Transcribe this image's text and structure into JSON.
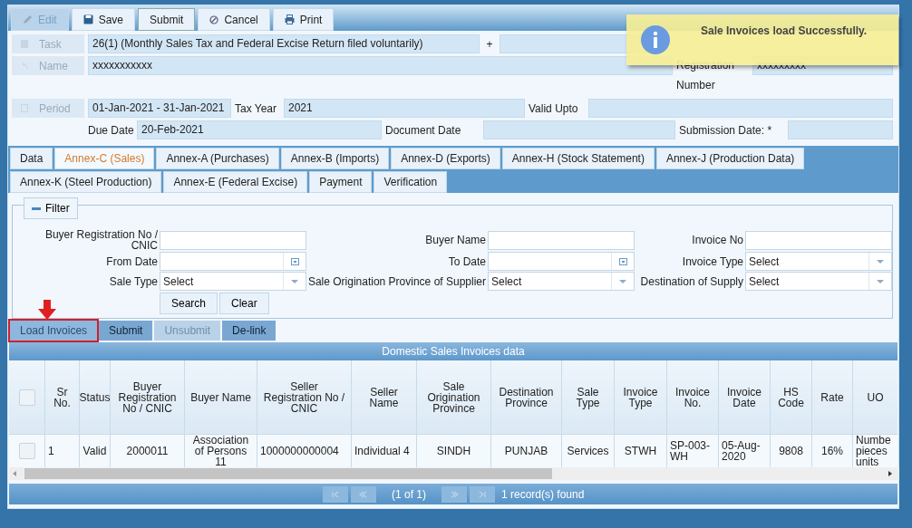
{
  "toolbar": [
    {
      "label": "Edit",
      "disabled": true
    },
    {
      "label": "Save",
      "disabled": false
    },
    {
      "label": "Submit",
      "disabled": false
    },
    {
      "label": "Cancel",
      "disabled": false
    },
    {
      "label": "Print",
      "disabled": false
    }
  ],
  "header": {
    "task_label": "Task",
    "task": "26(1) (Monthly Sales Tax and Federal Excise Return filed voluntarily)",
    "plus": "+",
    "name_label": "Name",
    "name": "xxxxxxxxxxx",
    "registration_label": "Registration Number",
    "registration": "xxxxxxxxx",
    "period_label": "Period",
    "period": "01-Jan-2021 -  31-Jan-2021",
    "tax_year_label": "Tax Year",
    "tax_year": "2021",
    "valid_upto_label": "Valid Upto",
    "due_date_label": "Due Date",
    "due_date": "20-Feb-2021",
    "document_date_label": "Document Date",
    "submission_date_label": "Submission Date: *"
  },
  "toast": {
    "message": "Sale Invoices load Successfully."
  },
  "tab_rows": [
    [
      {
        "label": "Data",
        "selected": false
      },
      {
        "label": "Annex-C (Sales)",
        "selected": true
      },
      {
        "label": "Annex-A (Purchases)",
        "selected": false
      },
      {
        "label": "Annex-B (Imports)",
        "selected": false
      },
      {
        "label": "Annex-D (Exports)",
        "selected": false
      },
      {
        "label": "Annex-H (Stock Statement)",
        "selected": false
      },
      {
        "label": "Annex-J (Production Data)",
        "selected": false
      }
    ],
    [
      {
        "label": "Annex-K (Steel Production)",
        "selected": false
      },
      {
        "label": "Annex-E (Federal Excise)",
        "selected": false
      },
      {
        "label": "Payment",
        "selected": false
      },
      {
        "label": "Verification",
        "selected": false
      }
    ]
  ],
  "filter": {
    "legend": "Filter",
    "expanded": true,
    "fields": [
      {
        "label": "Buyer Registration No / CNIC",
        "kind": "text"
      },
      {
        "label": "Buyer Name",
        "kind": "text"
      },
      {
        "label": "Invoice No",
        "kind": "text"
      },
      {
        "label": "From Date",
        "kind": "date"
      },
      {
        "label": "To Date",
        "kind": "date"
      },
      {
        "label": "Invoice Type",
        "kind": "select",
        "value": "Select"
      },
      {
        "label": "Sale Type",
        "kind": "select",
        "value": "Select"
      },
      {
        "label": "Sale Origination Province of Supplier",
        "kind": "select",
        "value": "Select"
      },
      {
        "label": "Destination of Supply",
        "kind": "select",
        "value": "Select"
      }
    ],
    "buttons": [
      "Search",
      "Clear"
    ]
  },
  "actions": [
    {
      "label": "Load Invoices",
      "disabled": false,
      "highlighted": true
    },
    {
      "label": "Submit",
      "disabled": false,
      "highlighted": false
    },
    {
      "label": "Unsubmit",
      "disabled": true,
      "highlighted": false
    },
    {
      "label": "De-link",
      "disabled": false,
      "highlighted": false
    }
  ],
  "grid": {
    "title": "Domestic Sales Invoices data",
    "select_all": false,
    "columns": [
      "Sr No.",
      "Status",
      "Buyer Registration No / CNIC",
      "Buyer Name",
      "Seller Registration No / CNIC",
      "Seller Name",
      "Sale Origination Province",
      "Destination Province",
      "Sale Type",
      "Invoice Type",
      "Invoice No.",
      "Invoice Date",
      "HS Code",
      "Rate",
      "UO"
    ],
    "rows": [
      {
        "checked": false,
        "cells": [
          "1",
          "Valid",
          "2000011",
          "Association of Persons 11",
          "1000000000004",
          "Individual 4",
          "SINDH",
          "PUNJAB",
          "Services",
          "STWH",
          "SP-003-WH",
          "05-Aug-2020",
          "9808",
          "16%",
          "Numbe pieces units"
        ]
      }
    ],
    "page": "(1 of 1)",
    "records": "1 record(s) found"
  }
}
